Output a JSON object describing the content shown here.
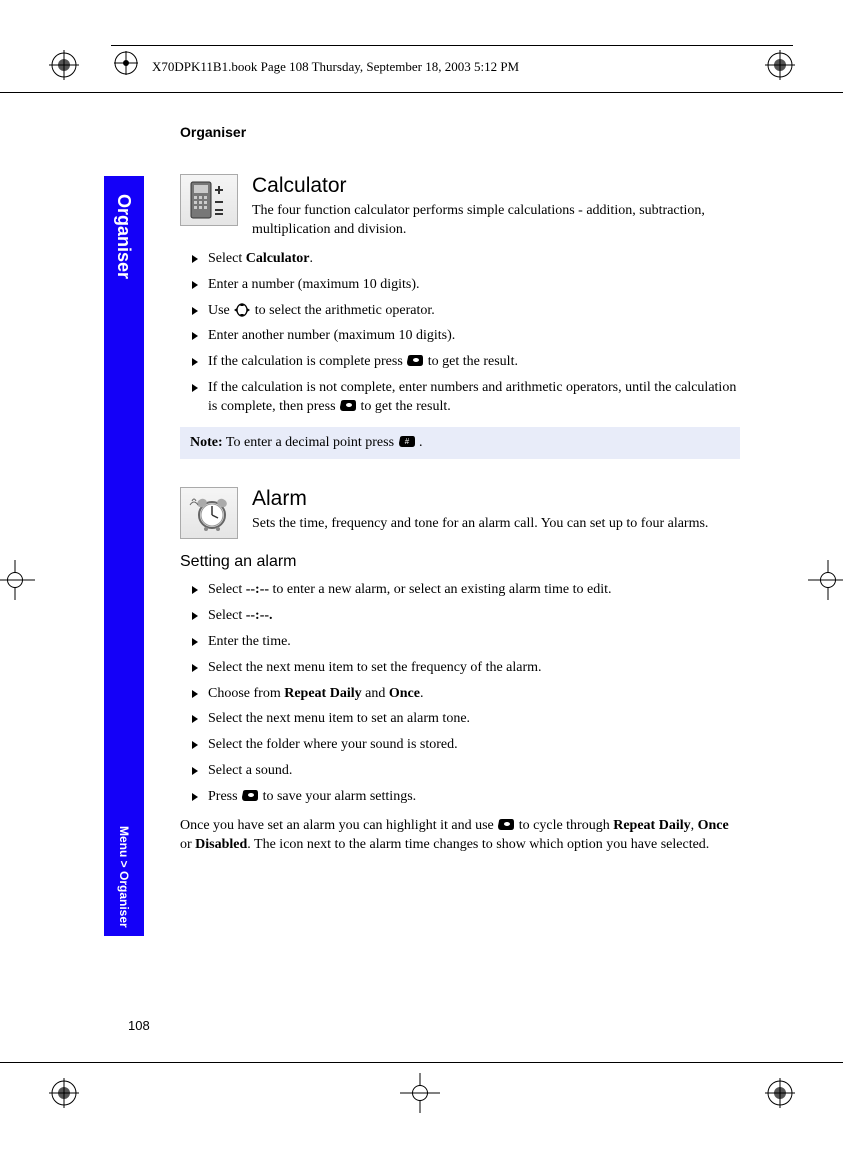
{
  "book_info": "X70DPK11B1.book  Page 108  Thursday, September 18, 2003  5:12 PM",
  "running_head": "Organiser",
  "side_tab": {
    "top": "Organiser",
    "bottom": "Menu > Organiser"
  },
  "page_number": "108",
  "calculator": {
    "heading": "Calculator",
    "desc": "The four function calculator performs simple calculations - addition, subtraction, multiplication and division.",
    "steps": {
      "s1_pre": "Select ",
      "s1_bold": "Calculator",
      "s1_post": ".",
      "s2": "Enter a number (maximum 10 digits).",
      "s3_pre": "Use ",
      "s3_post": " to select the arithmetic operator.",
      "s4": "Enter another number (maximum 10 digits).",
      "s5_pre": "If the calculation is complete press ",
      "s5_post": " to get the result.",
      "s6_pre": "If the calculation is not complete, enter numbers and arithmetic operators, until the calculation is complete, then press ",
      "s6_post": " to get the result."
    },
    "note_bold": "Note:",
    "note_pre": " To enter a decimal point press ",
    "note_post": " ."
  },
  "alarm": {
    "heading": "Alarm",
    "desc": "Sets the time, frequency and tone for an alarm call. You can set up to four alarms.",
    "sub_heading": "Setting an alarm",
    "steps": {
      "a1_pre": "Select ",
      "a1_bold": "--:--",
      "a1_post": " to enter a new alarm, or select an existing alarm time to edit.",
      "a2_pre": "Select ",
      "a2_bold": "--:--.",
      "a3": "Enter the time.",
      "a4": "Select the next menu item to set the frequency of the alarm.",
      "a5_pre": "Choose from ",
      "a5_b1": "Repeat Daily",
      "a5_mid": " and ",
      "a5_b2": "Once",
      "a5_post": ".",
      "a6": "Select the next menu item to set an alarm tone.",
      "a7": "Select the folder where your sound is stored.",
      "a8": "Select a sound.",
      "a9_pre": "Press ",
      "a9_post": " to save your alarm settings."
    },
    "para_pre": "Once you have set an alarm you can highlight it and use ",
    "para_mid1": " to cycle through ",
    "para_b1": "Repeat Daily",
    "para_c1": ", ",
    "para_b2": "Once",
    "para_c2": " or ",
    "para_b3": "Disabled",
    "para_post": ". The icon next to the alarm time changes to show which option you have selected."
  }
}
